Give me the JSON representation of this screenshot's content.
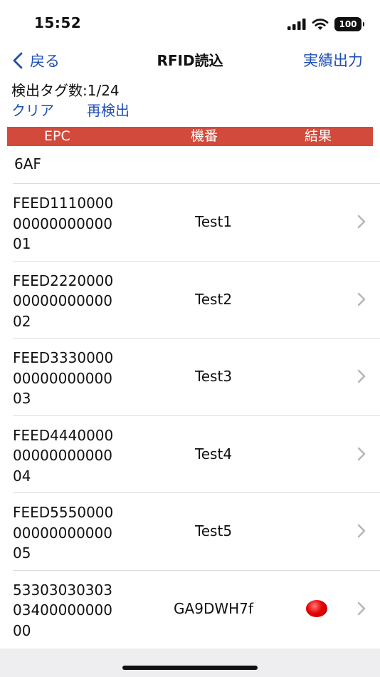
{
  "status": {
    "time": "15:52",
    "battery": "100"
  },
  "nav": {
    "back_label": "戻る",
    "title": "RFID読込",
    "export_label": "実績出力"
  },
  "summary": {
    "tag_count": "検出タグ数:1/24"
  },
  "actions": {
    "clear_label": "クリア",
    "rescan_label": "再検出"
  },
  "table": {
    "columns": [
      "EPC",
      "機番",
      "結果"
    ],
    "first_epc": "6AF",
    "rows": [
      {
        "epc": "FEED1110000\n00000000000\n01",
        "model": "Test1",
        "result": ""
      },
      {
        "epc": "FEED2220000\n00000000000\n02",
        "model": "Test2",
        "result": ""
      },
      {
        "epc": "FEED3330000\n00000000000\n03",
        "model": "Test3",
        "result": ""
      },
      {
        "epc": "FEED4440000\n00000000000\n04",
        "model": "Test4",
        "result": ""
      },
      {
        "epc": "FEED5550000\n00000000000\n05",
        "model": "Test5",
        "result": ""
      },
      {
        "epc": "53303030303\n03400000000\n00",
        "model": "GA9DWH7f",
        "result": "red-dot"
      }
    ]
  },
  "colors": {
    "accent": "#1d4fb5",
    "header_bg": "#d14a3b",
    "result_red": "#e80000"
  },
  "icons": {
    "back": "chevron-left-icon",
    "row": "chevron-right-icon",
    "signal": "cellular-signal-icon",
    "wifi": "wifi-icon",
    "battery": "battery-icon"
  }
}
